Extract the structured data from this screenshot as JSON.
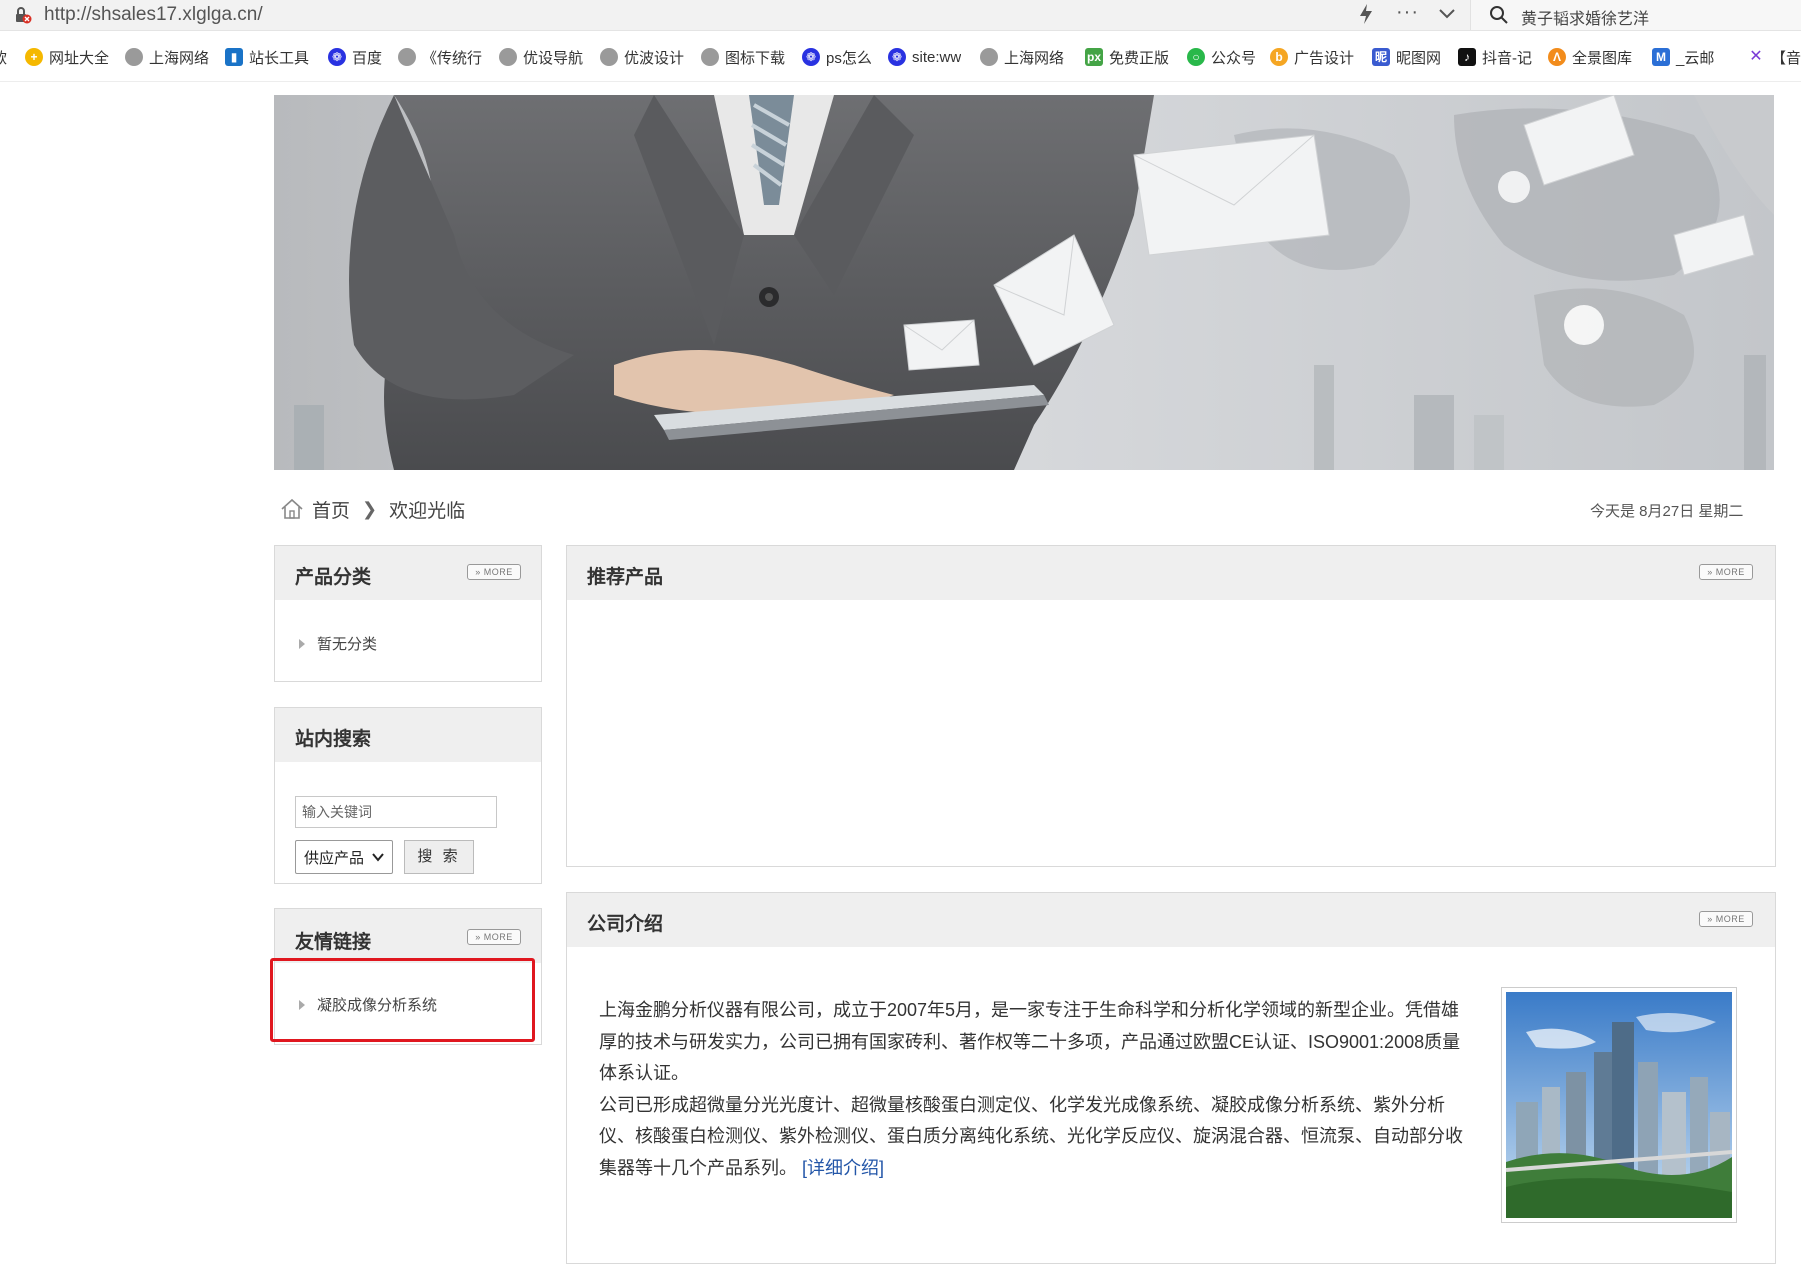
{
  "browser": {
    "url": "http://shsales17.xlglga.cn/",
    "search_text": "黄子韬求婚徐艺洋",
    "bookmarks": [
      {
        "label": "网址大全",
        "icon": "plus-icon",
        "color": "#f5b800"
      },
      {
        "label": "上海网络",
        "icon": "globe-icon",
        "color": "#9a9a9a"
      },
      {
        "label": "站长工具",
        "icon": "chart-icon",
        "color": "#1a73c7"
      },
      {
        "label": "百度",
        "icon": "paw-icon",
        "color": "#2932e1"
      },
      {
        "label": "《传统行",
        "icon": "globe-icon",
        "color": "#9a9a9a"
      },
      {
        "label": "优设导航",
        "icon": "globe-icon",
        "color": "#9a9a9a"
      },
      {
        "label": "优波设计",
        "icon": "globe-icon",
        "color": "#9a9a9a"
      },
      {
        "label": "图标下载",
        "icon": "globe-icon",
        "color": "#9a9a9a"
      },
      {
        "label": "ps怎么",
        "icon": "paw-icon",
        "color": "#2932e1"
      },
      {
        "label": "site:ww",
        "icon": "paw-icon",
        "color": "#2932e1"
      },
      {
        "label": "上海网络",
        "icon": "globe-icon",
        "color": "#9a9a9a"
      },
      {
        "label": "免费正版",
        "icon": "px-icon",
        "color": "#44a446"
      },
      {
        "label": "公众号",
        "icon": "wechat-icon",
        "color": "#29b84a"
      },
      {
        "label": "广告设计",
        "icon": "b-icon",
        "color": "#f5a623"
      },
      {
        "label": "昵图网",
        "icon": "nipic-icon",
        "color": "#3a5bd0"
      },
      {
        "label": "抖音-记",
        "icon": "tiktok-icon",
        "color": "#111111"
      },
      {
        "label": "全景图库",
        "icon": "quanjing-icon",
        "color": "#f28c1c"
      },
      {
        "label": "_云邮",
        "icon": "mail-icon",
        "color": "#2b6fd6"
      },
      {
        "label": "【音律",
        "icon": "x-icon",
        "color": "#7a3bd6"
      }
    ]
  },
  "breadcrumb": {
    "home": "首页",
    "current": "欢迎光临"
  },
  "date_text": "今天是 8月27日 星期二",
  "more_label": "MORE",
  "product_category": {
    "title": "产品分类",
    "items": [
      "暂无分类"
    ]
  },
  "site_search": {
    "title": "站内搜索",
    "placeholder": "输入关键词",
    "select_value": "供应产品",
    "button": "搜 索"
  },
  "friend_links": {
    "title": "友情链接",
    "items": [
      "凝胶成像分析系统"
    ]
  },
  "recommended": {
    "title": "推荐产品"
  },
  "company_intro": {
    "title": "公司介绍",
    "para1": " 上海金鹏分析仪器有限公司，成立于2007年5月，是一家专注于生命科学和分析化学领域的新型企业。凭借雄厚的技术与研发实力，公司已拥有国家砖利、著作权等二十多项，产品通过欧盟CE认证、ISO9001:2008质量体系认证。",
    "para2": "公司已形成超微量分光光度计、超微量核酸蛋白测定仪、化学发光成像系统、凝胶成像分析系统、紫外分析仪、核酸蛋白检测仪、紫外检测仪、蛋白质分离纯化系统、光化学反应仪、旋涡混合器、恒流泵、自动部分收集器等十几个产品系列。",
    "detail_link": "[详细介绍]"
  }
}
